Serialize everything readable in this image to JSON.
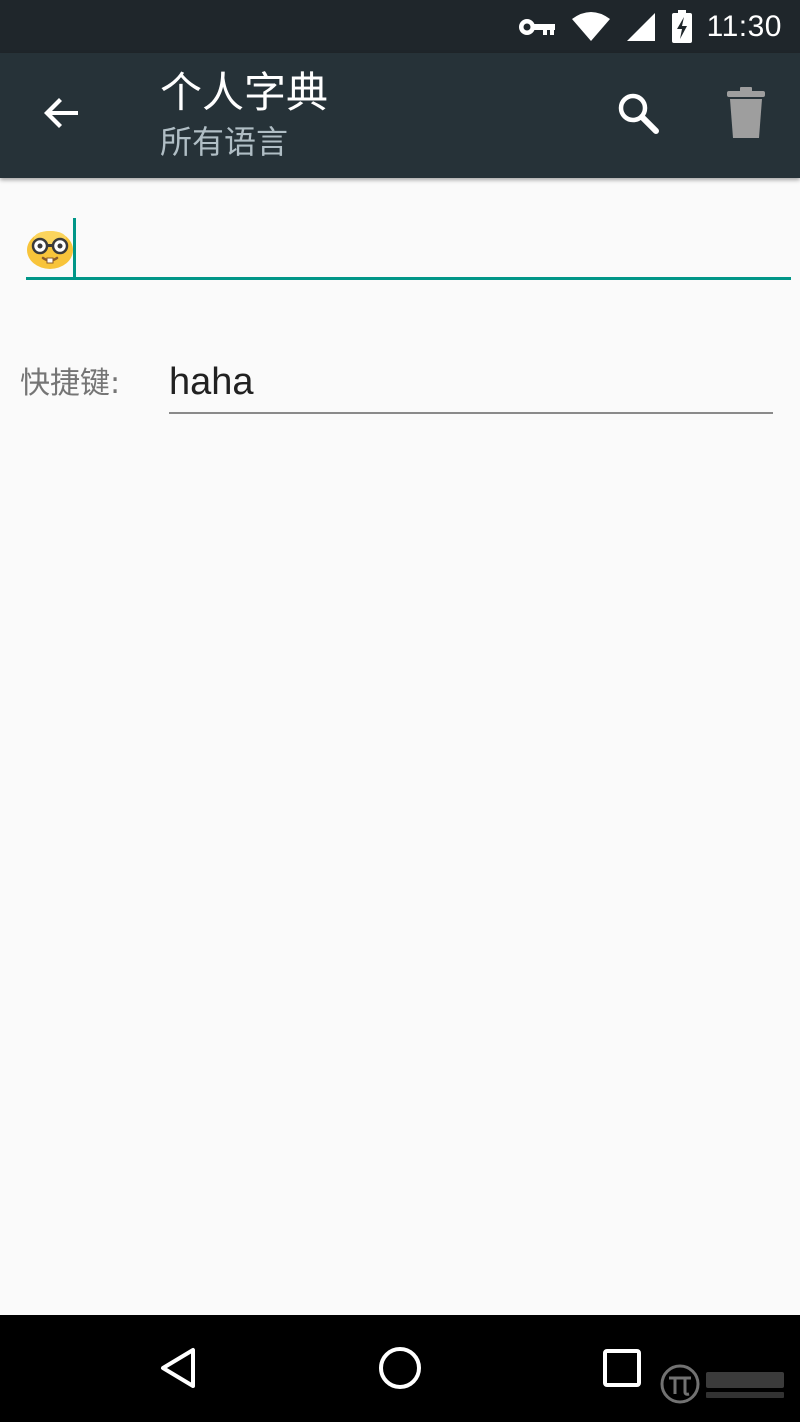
{
  "status_bar": {
    "time": "11:30",
    "icons": [
      "vpn-key-icon",
      "wifi-icon",
      "cellular-signal-icon",
      "battery-charging-icon"
    ]
  },
  "app_bar": {
    "title": "个人字典",
    "subtitle": "所有语言",
    "icons": [
      "arrow-back-icon",
      "search-icon",
      "delete-icon"
    ]
  },
  "word_field": {
    "emoji": "nerd-face-emoji",
    "value": ""
  },
  "shortcut": {
    "label": "快捷键:",
    "value": "haha"
  },
  "nav_bar": {
    "icons": [
      "nav-back-icon",
      "nav-home-icon",
      "nav-recents-icon"
    ]
  },
  "colors": {
    "status_bar_bg": "#1f262b",
    "app_bar_bg": "#263238",
    "accent": "#009688",
    "page_bg": "#fafafa",
    "nav_bar_bg": "#000000"
  }
}
